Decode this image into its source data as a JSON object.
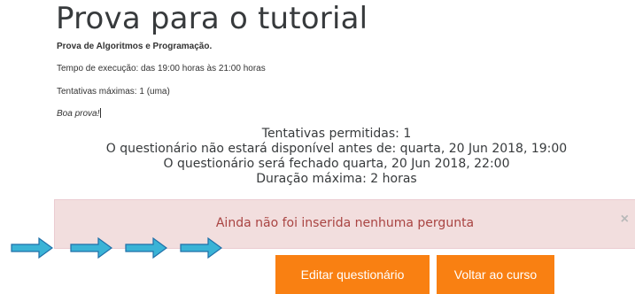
{
  "page": {
    "title": "Prova para o tutorial"
  },
  "intro": {
    "line1": "Prova de Algoritmos e Programação.",
    "line2": "Tempo de execução: das 19:00 horas às 21:00 horas",
    "line3": "Tentativas máximas:  1 (uma)",
    "line4": "Boa prova!"
  },
  "quizinfo": {
    "attempts": "Tentativas permitidas: 1",
    "opens": "O questionário não estará disponível antes de: quarta, 20 Jun 2018, 19:00",
    "closes": "O questionário será fechado quarta, 20 Jun 2018, 22:00",
    "duration": "Duração máxima: 2 horas"
  },
  "alert": {
    "message": "Ainda não foi inserida nenhuma pergunta",
    "close_symbol": "×"
  },
  "buttons": {
    "edit_label": "Editar questionário",
    "back_label": "Voltar ao curso"
  },
  "colors": {
    "button": "#f98012",
    "alert_bg": "#f2dede",
    "alert_text": "#a94442",
    "arrow": "#3ab3d6"
  },
  "decorations": {
    "arrow_icon": "arrow-right-icon",
    "arrow_count": 4
  }
}
